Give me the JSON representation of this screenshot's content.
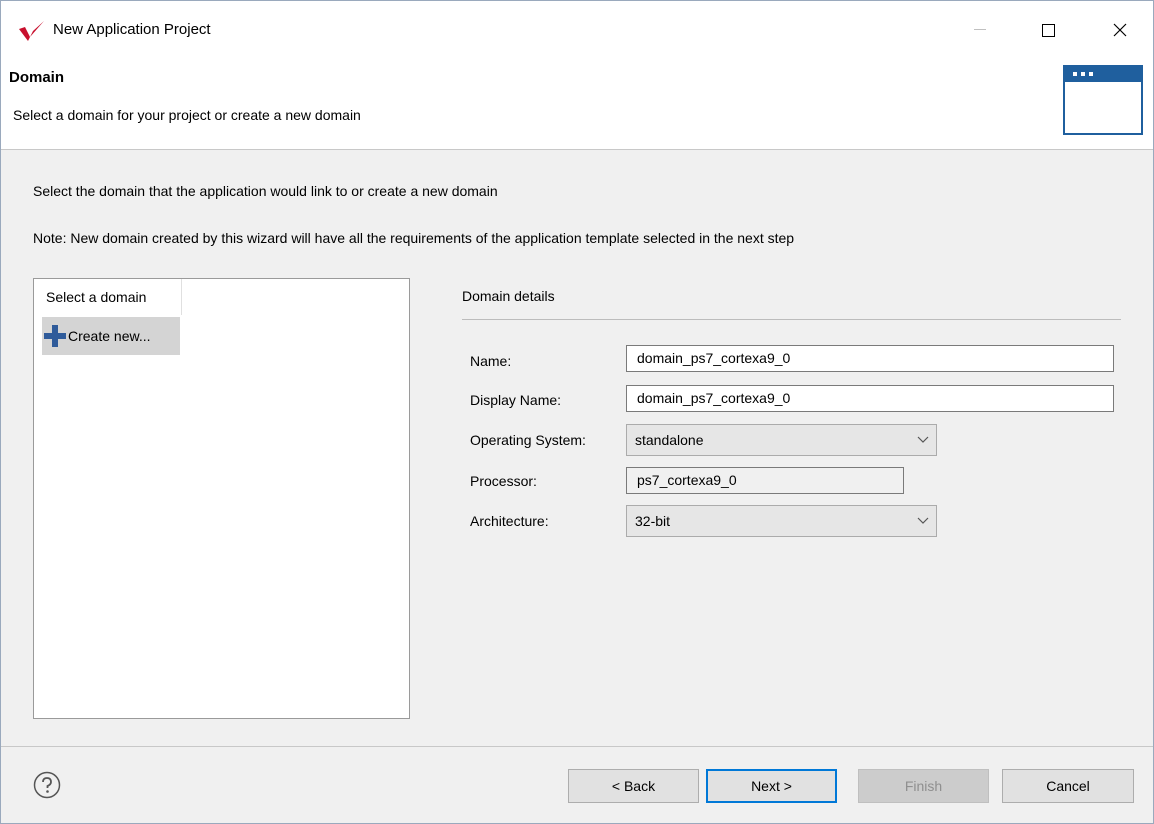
{
  "window": {
    "title": "New Application Project",
    "controls": {
      "minimize": "—",
      "maximize": "☐",
      "close": "✕"
    }
  },
  "header": {
    "title": "Domain",
    "description": "Select a domain for your project or create a new domain",
    "icon": "wizard-banner-window-icon"
  },
  "instructions": {
    "line1": "Select the domain that the application would link to or create a new domain",
    "line2": "Note: New domain created by this wizard will have all the requirements of the application template selected in the next step"
  },
  "domain_list": {
    "header": "Select a domain",
    "items": [
      {
        "label": "Create new...",
        "icon": "plus-icon"
      }
    ]
  },
  "details": {
    "title": "Domain details",
    "fields": {
      "name": {
        "label": "Name:",
        "value": "domain_ps7_cortexa9_0"
      },
      "display_name": {
        "label": "Display Name:",
        "value": "domain_ps7_cortexa9_0"
      },
      "os": {
        "label": "Operating System:",
        "value": "standalone"
      },
      "processor": {
        "label": "Processor:",
        "value": "ps7_cortexa9_0"
      },
      "architecture": {
        "label": "Architecture:",
        "value": "32-bit"
      }
    }
  },
  "footer": {
    "back": "< Back",
    "next": "Next >",
    "finish": "Finish",
    "cancel": "Cancel",
    "help_icon": "help-question-icon"
  },
  "colors": {
    "brand": "#c8102e",
    "accent": "#0078d7",
    "banner": "#1f5f9e",
    "plus": "#2f5b9a"
  }
}
